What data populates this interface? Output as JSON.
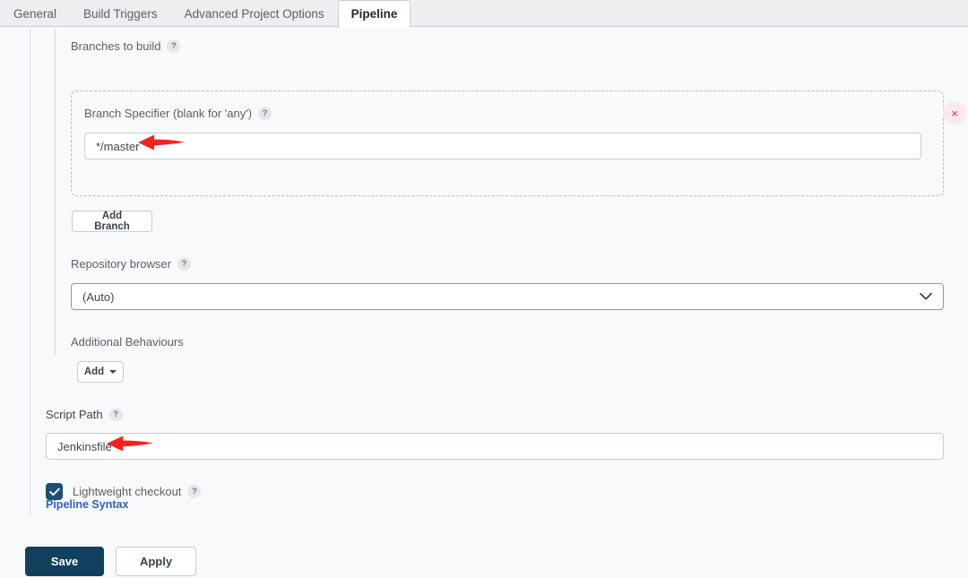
{
  "tabs": [
    {
      "label": "General",
      "active": false
    },
    {
      "label": "Build Triggers",
      "active": false
    },
    {
      "label": "Advanced Project Options",
      "active": false
    },
    {
      "label": "Pipeline",
      "active": true
    }
  ],
  "help_glyph": "?",
  "branches": {
    "section_label": "Branches to build",
    "specifier_label": "Branch Specifier (blank for 'any')",
    "specifier_value": "*/master",
    "specifier_placeholder": "",
    "remove_glyph": "×",
    "add_branch_label": "Add Branch"
  },
  "repository_browser": {
    "label": "Repository browser",
    "selected": "(Auto)"
  },
  "additional_behaviours": {
    "label": "Additional Behaviours",
    "add_label": "Add"
  },
  "script_path": {
    "label": "Script Path",
    "value": "Jenkinsfile",
    "placeholder": ""
  },
  "lightweight_checkout": {
    "label": "Lightweight checkout",
    "checked": true
  },
  "pipeline_syntax_link": "Pipeline Syntax",
  "footer": {
    "save_label": "Save",
    "apply_label": "Apply"
  },
  "colors": {
    "page_background": "#f8f9fa",
    "tabbar_background": "#eceeef",
    "accent_navy": "#11405f",
    "checkbox_navy": "#1c4f76",
    "link_blue": "#2d61c4",
    "remove_red": "#e1294a",
    "annotation_red": "#fa2020"
  },
  "annotations": [
    {
      "name": "arrow-to-branch-specifier",
      "direction": "left"
    },
    {
      "name": "arrow-to-script-path",
      "direction": "left"
    }
  ]
}
